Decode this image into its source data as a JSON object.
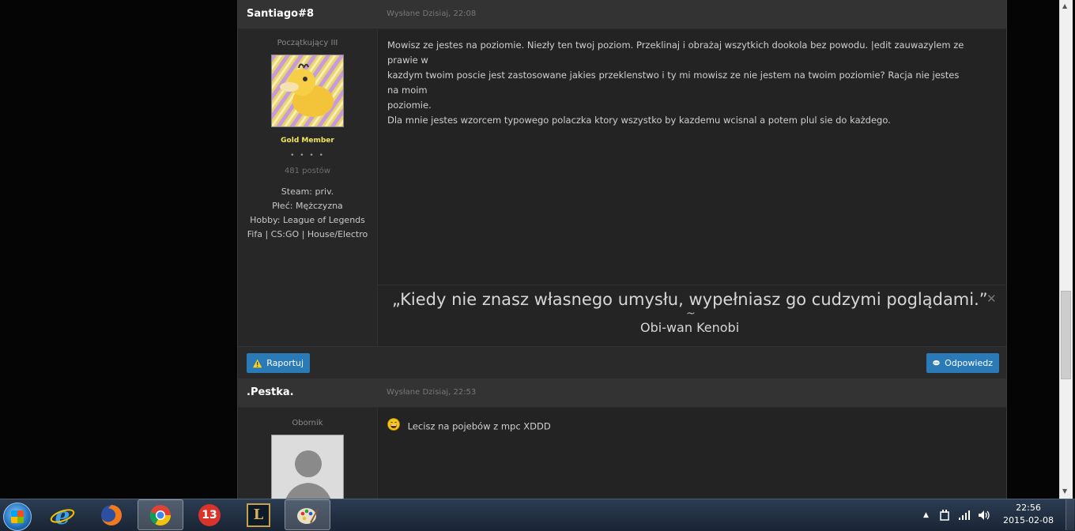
{
  "posts": [
    {
      "author": "Santiago#8",
      "posted": "Wysłane Dzisiaj, 22:08",
      "rank": "Początkujący III",
      "group": "Gold Member",
      "pips": "• • • •",
      "post_count": "481 postów",
      "custom_fields": [
        "Steam: priv.",
        "Płeć: Mężczyzna",
        "Hobby: League of Legends",
        "Fifa | CS:GO | House/Electro"
      ],
      "body": [
        "Mowisz ze jestes na poziomie. Niezły ten twoj poziom. Przeklinaj i obrażaj wszytkich dookola bez powodu. |edit zauwazylem ze prawie w",
        "kazdym twoim poscie jest zastosowane jakies przeklenstwo i ty mi mowisz ze nie jestem na twoim poziomie? Racja nie jestes na moim",
        "poziomie.",
        "Dla mnie jestes wzorcem typowego polaczka ktory wszystko by kazdemu wcisnal a potem plul sie do każdego."
      ],
      "signature": {
        "quote": "„Kiedy nie znasz własnego umysłu, wypełniasz go cudzymi poglądami.”",
        "author": "Obi-wan Kenobi",
        "tilde": "~",
        "close": "✕"
      },
      "report_label": "Raportuj",
      "reply_label": "Odpowiedz"
    },
    {
      "author": ".Pestka.",
      "posted": "Wysłane Dzisiaj, 22:53",
      "rank": "Obornik",
      "body": "Lecisz na pojebów z mpc XDDD"
    }
  ],
  "taskbar": {
    "apps": [
      "internet-explorer-icon",
      "firefox-icon",
      "chrome-icon",
      "app-13-icon",
      "league-of-legends-icon",
      "paint-icon"
    ],
    "app_13_label": "13",
    "lol_label": "L",
    "clock_time": "22:56",
    "clock_date": "2015-02-08",
    "tray_arrow": "▲"
  },
  "colors": {
    "accent_button": "#2b7ab8",
    "group_color": "#f2e65a"
  }
}
